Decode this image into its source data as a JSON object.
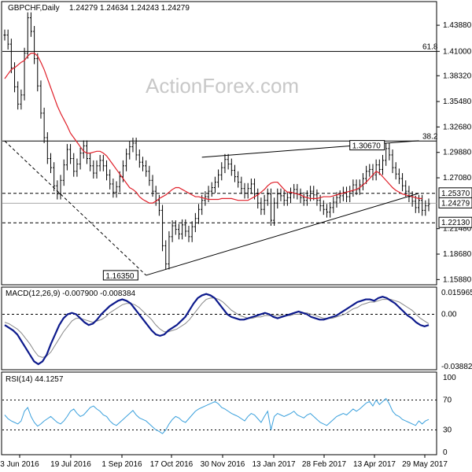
{
  "header": {
    "symbol": "GBPCHF,Daily",
    "ohlc": "1.24279 1.24634 1.24243 1.24279"
  },
  "watermark": "ActionForex.com",
  "colors": {
    "candle": "#000000",
    "ma": "#e0202a",
    "macd": "#0d1a8c",
    "signal": "#888888",
    "rsi": "#3aa0dc",
    "grid_dash": "#000000"
  },
  "chart_data": [
    {
      "type": "candlestick",
      "name": "price",
      "x_tick_labels": [
        "3 Jun 2016",
        "19 Jul 2016",
        "1 Sep 2016",
        "17 Oct 2016",
        "30 Nov 2016",
        "13 Jan 2017",
        "28 Feb 2017",
        "13 Apr 2017",
        "29 May 2017"
      ],
      "y_tick_labels": [
        "1.43880",
        "1.41000",
        "1.38320",
        "1.35480",
        "1.32680",
        "1.29880",
        "1.27080",
        "1.24279",
        "1.21480",
        "1.18680",
        "1.15880"
      ],
      "ylim": [
        1.1565,
        1.451
      ],
      "close": [
        1.428,
        1.418,
        1.392,
        1.371,
        1.352,
        1.362,
        1.408,
        1.447,
        1.432,
        1.402,
        1.372,
        1.342,
        1.315,
        1.292,
        1.282,
        1.262,
        1.253,
        1.268,
        1.285,
        1.302,
        1.292,
        1.278,
        1.286,
        1.298,
        1.306,
        1.292,
        1.284,
        1.276,
        1.284,
        1.29,
        1.284,
        1.274,
        1.264,
        1.255,
        1.261,
        1.272,
        1.284,
        1.297,
        1.305,
        1.309,
        1.296,
        1.288,
        1.284,
        1.278,
        1.268,
        1.256,
        1.246,
        1.235,
        1.196,
        1.176,
        1.206,
        1.218,
        1.214,
        1.209,
        1.219,
        1.212,
        1.206,
        1.217,
        1.226,
        1.236,
        1.246,
        1.25,
        1.256,
        1.26,
        1.266,
        1.274,
        1.282,
        1.291,
        1.286,
        1.279,
        1.272,
        1.266,
        1.259,
        1.254,
        1.259,
        1.264,
        1.253,
        1.243,
        1.236,
        1.246,
        1.253,
        1.224,
        1.243,
        1.253,
        1.251,
        1.246,
        1.249,
        1.254,
        1.258,
        1.253,
        1.249,
        1.246,
        1.251,
        1.256,
        1.252,
        1.246,
        1.24,
        1.236,
        1.233,
        1.238,
        1.244,
        1.249,
        1.251,
        1.255,
        1.25,
        1.256,
        1.263,
        1.258,
        1.263,
        1.27,
        1.278,
        1.28,
        1.274,
        1.285,
        1.28,
        1.29,
        1.303,
        1.296,
        1.282,
        1.275,
        1.27,
        1.262,
        1.256,
        1.25,
        1.245,
        1.238,
        1.246,
        1.235,
        1.24,
        1.242
      ],
      "ma_label": "MA (red)",
      "ma_values": [
        1.38,
        1.385,
        1.39,
        1.392,
        1.395,
        1.398,
        1.4,
        1.405,
        1.408,
        1.408,
        1.405,
        1.398,
        1.39,
        1.38,
        1.37,
        1.36,
        1.35,
        1.342,
        1.335,
        1.328,
        1.32,
        1.315,
        1.31,
        1.305,
        1.3,
        1.298,
        1.298,
        1.299,
        1.3,
        1.3,
        1.298,
        1.295,
        1.29,
        1.285,
        1.28,
        1.275,
        1.27,
        1.265,
        1.26,
        1.258,
        1.255,
        1.25,
        1.247,
        1.245,
        1.243,
        1.243,
        1.245,
        1.248,
        1.25,
        1.252,
        1.255,
        1.258,
        1.26,
        1.26,
        1.258,
        1.256,
        1.254,
        1.252,
        1.25,
        1.25,
        1.249,
        1.248,
        1.247,
        1.247,
        1.247,
        1.247,
        1.248,
        1.248,
        1.248,
        1.248,
        1.247,
        1.246,
        1.246,
        1.246,
        1.246,
        1.248,
        1.25,
        1.252,
        1.255,
        1.258,
        1.262,
        1.265,
        1.266,
        1.266,
        1.262,
        1.258,
        1.255,
        1.255,
        1.254,
        1.253,
        1.252,
        1.25,
        1.249,
        1.248,
        1.248,
        1.248,
        1.249,
        1.25,
        1.25,
        1.25,
        1.251,
        1.252,
        1.253,
        1.254,
        1.255,
        1.256,
        1.257,
        1.258,
        1.26,
        1.263,
        1.266,
        1.27,
        1.274,
        1.278,
        1.276,
        1.272,
        1.268,
        1.264,
        1.26,
        1.257,
        1.255,
        1.253,
        1.252,
        1.251,
        1.25,
        1.249,
        1.248,
        1.248
      ],
      "price_labels": [
        {
          "text": "1.43880",
          "value": 1.4388
        },
        {
          "text": "1.41000",
          "value": 1.41
        },
        {
          "text": "1.38320",
          "value": 1.3832
        },
        {
          "text": "1.35480",
          "value": 1.3548
        },
        {
          "text": "1.32680",
          "value": 1.3268
        },
        {
          "text": "1.29880",
          "value": 1.2988
        },
        {
          "text": "1.27080",
          "value": 1.2708
        },
        {
          "text": "1.21480",
          "value": 1.2148
        },
        {
          "text": "1.18680",
          "value": 1.1868
        },
        {
          "text": "1.15880",
          "value": 1.1588
        }
      ],
      "boxed_price_labels": [
        {
          "text": "1.25370",
          "value": 1.2537
        },
        {
          "text": "1.24279",
          "value": 1.24279
        },
        {
          "text": "1.22130",
          "value": 1.2213
        }
      ],
      "fib_levels": [
        {
          "text": "61.8",
          "value": 1.41
        },
        {
          "text": "38.2",
          "value": 1.3113
        }
      ],
      "horizontal_levels": [
        1.2537,
        1.24279,
        1.2213
      ],
      "annotations": [
        {
          "text": "1.30670",
          "value": 1.3067
        },
        {
          "text": "1.16350",
          "value": 1.1635
        }
      ]
    },
    {
      "type": "line",
      "name": "MACD(12,26,9) -0.007900 -0.008384",
      "ylim": [
        -0.0388,
        0.016
      ],
      "tick_labels": [
        "0.015965",
        "0.00",
        "-0.038821"
      ],
      "macd": [
        -0.008,
        -0.01,
        -0.012,
        -0.015,
        -0.02,
        -0.025,
        -0.03,
        -0.035,
        -0.037,
        -0.035,
        -0.03,
        -0.022,
        -0.015,
        -0.008,
        -0.003,
        0.0,
        0.001,
        0.0,
        -0.003,
        -0.006,
        -0.008,
        -0.007,
        -0.004,
        0.0,
        0.003,
        0.006,
        0.008,
        0.01,
        0.011,
        0.01,
        0.008,
        0.004,
        0.0,
        -0.004,
        -0.008,
        -0.012,
        -0.015,
        -0.016,
        -0.015,
        -0.012,
        -0.01,
        -0.008,
        -0.005,
        -0.002,
        0.003,
        0.008,
        0.012,
        0.014,
        0.015,
        0.014,
        0.012,
        0.008,
        0.004,
        0.0,
        -0.002,
        -0.003,
        -0.004,
        -0.004,
        -0.003,
        -0.002,
        -0.001,
        0.0,
        0.001,
        0.0,
        -0.002,
        -0.003,
        -0.002,
        -0.001,
        0.0,
        0.001,
        0.002,
        0.001,
        0.0,
        -0.002,
        -0.003,
        -0.004,
        -0.004,
        -0.003,
        -0.002,
        -0.001,
        0.001,
        0.003,
        0.005,
        0.007,
        0.009,
        0.01,
        0.011,
        0.011,
        0.01,
        0.012,
        0.013,
        0.012,
        0.01,
        0.008,
        0.005,
        0.002,
        -0.001,
        -0.003,
        -0.006,
        -0.008,
        -0.009,
        -0.008
      ],
      "signal": [
        -0.006,
        -0.007,
        -0.009,
        -0.011,
        -0.014,
        -0.018,
        -0.022,
        -0.027,
        -0.031,
        -0.032,
        -0.031,
        -0.028,
        -0.023,
        -0.018,
        -0.013,
        -0.009,
        -0.005,
        -0.003,
        -0.003,
        -0.004,
        -0.005,
        -0.006,
        -0.005,
        -0.004,
        -0.002,
        0.001,
        0.003,
        0.005,
        0.007,
        0.008,
        0.008,
        0.007,
        0.005,
        0.002,
        -0.001,
        -0.004,
        -0.008,
        -0.011,
        -0.013,
        -0.013,
        -0.012,
        -0.011,
        -0.009,
        -0.007,
        -0.004,
        0.0,
        0.004,
        0.008,
        0.011,
        0.012,
        0.012,
        0.011,
        0.009,
        0.006,
        0.003,
        0.001,
        -0.001,
        -0.002,
        -0.003,
        -0.003,
        -0.002,
        -0.002,
        -0.001,
        -0.001,
        -0.001,
        -0.001,
        -0.001,
        -0.001,
        -0.001,
        0.0,
        0.0,
        0.001,
        0.001,
        0.0,
        -0.001,
        -0.002,
        -0.003,
        -0.003,
        -0.003,
        -0.002,
        -0.001,
        0.0,
        0.002,
        0.004,
        0.005,
        0.007,
        0.008,
        0.009,
        0.009,
        0.01,
        0.011,
        0.011,
        0.011,
        0.01,
        0.009,
        0.007,
        0.005,
        0.003,
        0.0,
        -0.003,
        -0.005,
        -0.007
      ]
    },
    {
      "type": "line",
      "name": "RSI(14) 44.1257",
      "ylim": [
        0,
        100
      ],
      "tick_labels": [
        "100",
        "70",
        "30",
        "0"
      ],
      "levels": [
        70,
        30
      ],
      "values": [
        50,
        45,
        42,
        40,
        38,
        42,
        55,
        60,
        48,
        40,
        35,
        38,
        42,
        45,
        48,
        44,
        40,
        38,
        42,
        48,
        55,
        58,
        52,
        48,
        50,
        55,
        60,
        62,
        58,
        55,
        50,
        48,
        42,
        38,
        36,
        40,
        44,
        48,
        52,
        56,
        50,
        46,
        44,
        42,
        38,
        34,
        30,
        28,
        25,
        30,
        38,
        44,
        48,
        46,
        42,
        40,
        45,
        50,
        55,
        58,
        60,
        62,
        64,
        66,
        68,
        65,
        60,
        58,
        55,
        52,
        50,
        48,
        45,
        42,
        48,
        52,
        50,
        45,
        40,
        48,
        55,
        30,
        48,
        52,
        50,
        48,
        50,
        52,
        55,
        50,
        48,
        46,
        50,
        52,
        48,
        44,
        40,
        38,
        36,
        40,
        44,
        48,
        50,
        52,
        50,
        54,
        58,
        55,
        58,
        62,
        66,
        68,
        62,
        70,
        64,
        68,
        72,
        65,
        55,
        50,
        48,
        44,
        42,
        40,
        38,
        36,
        42,
        38,
        42,
        44
      ]
    }
  ]
}
